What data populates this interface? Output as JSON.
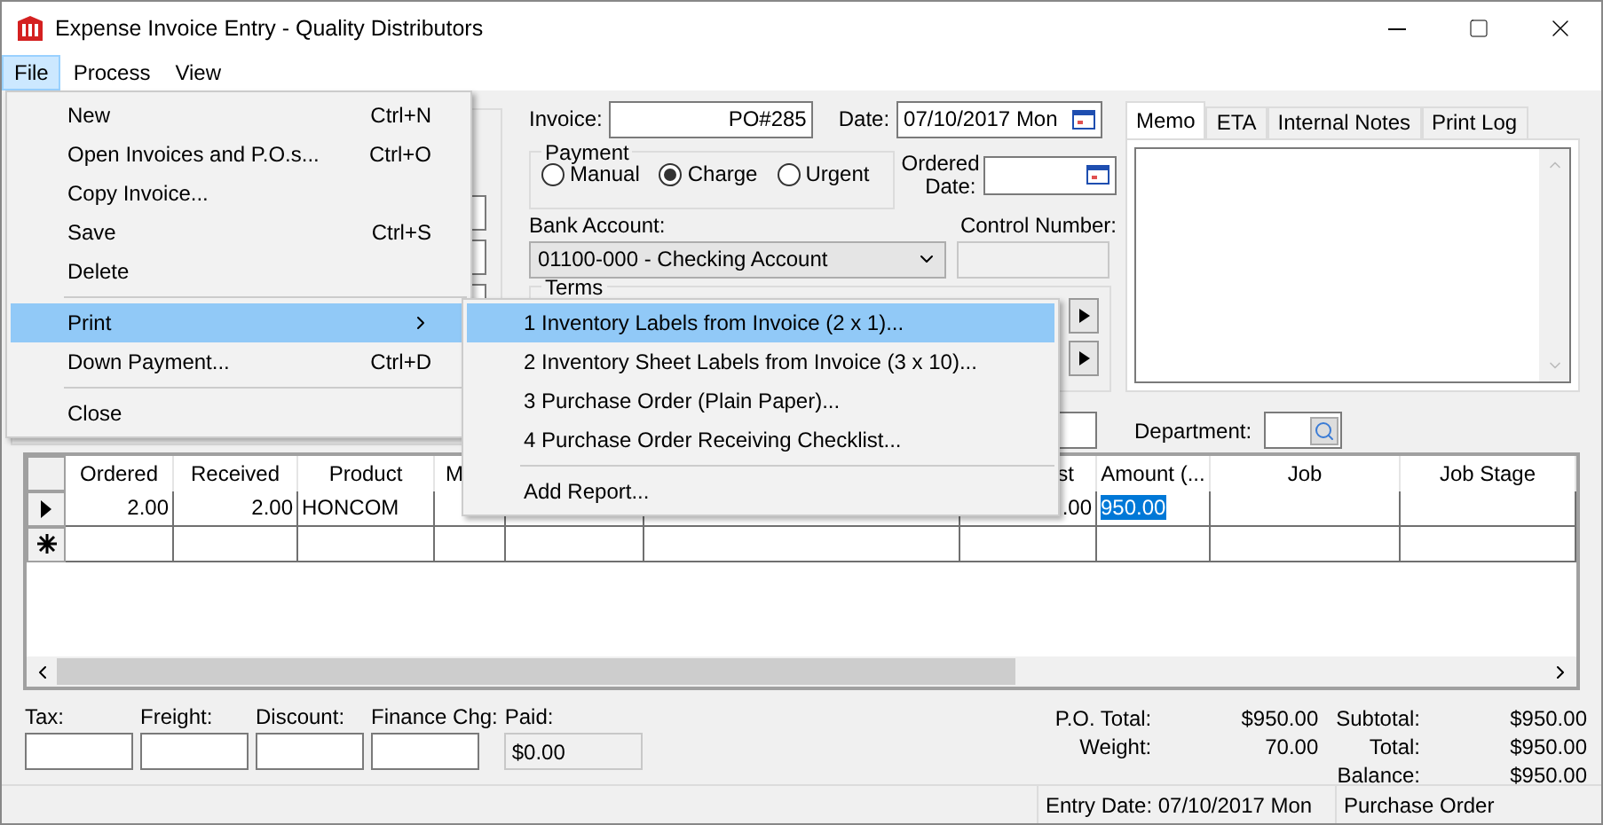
{
  "window": {
    "title": "Expense Invoice Entry - Quality Distributors"
  },
  "menu_bar": [
    {
      "label": "File",
      "selected": true
    },
    {
      "label": "Process",
      "selected": false
    },
    {
      "label": "View",
      "selected": false
    }
  ],
  "file_menu": [
    {
      "kind": "item",
      "label": "New",
      "shortcut": "Ctrl+N",
      "selected": false
    },
    {
      "kind": "item",
      "label": "Open Invoices and P.O.s...",
      "shortcut": "Ctrl+O",
      "selected": false
    },
    {
      "kind": "item",
      "label": "Copy Invoice...",
      "selected": false
    },
    {
      "kind": "item",
      "label": "Save",
      "shortcut": "Ctrl+S",
      "selected": false
    },
    {
      "kind": "item",
      "label": "Delete",
      "selected": false
    },
    {
      "kind": "separator"
    },
    {
      "kind": "submenu",
      "label": "Print",
      "selected": true
    },
    {
      "kind": "item",
      "label": "Down Payment...",
      "shortcut": "Ctrl+D",
      "selected": false
    },
    {
      "kind": "separator"
    },
    {
      "kind": "item",
      "label": "Close",
      "selected": false
    }
  ],
  "print_submenu": [
    {
      "kind": "item",
      "label": "1 Inventory Labels from Invoice (2 x 1)...",
      "selected": true
    },
    {
      "kind": "item",
      "label": "2 Inventory Sheet Labels from Invoice (3 x 10)...",
      "selected": false
    },
    {
      "kind": "item",
      "label": "3 Purchase Order (Plain Paper)...",
      "selected": false
    },
    {
      "kind": "item",
      "label": "4 Purchase Order Receiving Checklist...",
      "selected": false
    },
    {
      "kind": "separator"
    },
    {
      "kind": "item",
      "label": "Add Report...",
      "selected": false
    }
  ],
  "form": {
    "invoice_label": "Invoice:",
    "invoice": "PO#285",
    "date_label": "Date:",
    "date": "07/10/2017 Mon",
    "payment": {
      "title": "Payment",
      "options": [
        {
          "label": "Manual",
          "selected": false
        },
        {
          "label": "Charge",
          "selected": true
        },
        {
          "label": "Urgent",
          "selected": false
        }
      ]
    },
    "ordered_date_label": "Ordered Date:",
    "bank_account_label": "Bank Account:",
    "bank_account": "01100-000 - Checking Account",
    "control_number_label": "Control Number:",
    "terms_title": "Terms",
    "department_label": "Department:"
  },
  "notes_tabs": [
    {
      "label": "Memo",
      "selected": true
    },
    {
      "label": "ETA",
      "selected": false
    },
    {
      "label": "Internal Notes",
      "selected": false
    },
    {
      "label": "Print Log",
      "selected": false
    }
  ],
  "grid": {
    "columns": [
      {
        "label": "Ordered"
      },
      {
        "label": "Received"
      },
      {
        "label": "Product"
      },
      {
        "label": "M"
      },
      {},
      {},
      {
        "label": "st"
      },
      {
        "label": "Amount (..."
      },
      {
        "label": "Job"
      },
      {
        "label": "Job Stage"
      }
    ],
    "rows": [
      {
        "kind": "current",
        "cells": [
          {
            "text": "2.00",
            "selected": false
          },
          {
            "text": "2.00",
            "selected": false
          },
          {
            "text": "HONCOM",
            "selected": false
          },
          null,
          null,
          null,
          {
            "text": ".00",
            "selected": false
          },
          {
            "text": "950.00",
            "selected": true
          },
          null,
          null
        ]
      },
      {
        "kind": "new",
        "cells": [
          null,
          null,
          null,
          null,
          null,
          null,
          null,
          null,
          null,
          null
        ]
      }
    ]
  },
  "charges": [
    {
      "label": "Tax:",
      "disabled": false
    },
    {
      "label": "Freight:",
      "disabled": false
    },
    {
      "label": "Discount:",
      "disabled": false
    },
    {
      "label": "Finance Chg:",
      "disabled": false
    },
    {
      "label": "Paid:",
      "value": "$0.00",
      "disabled": true
    }
  ],
  "totals_left": [
    {
      "label": "P.O. Total:",
      "value": "$950.00"
    },
    {
      "label": "Weight:",
      "value": "70.00"
    }
  ],
  "totals_right": [
    {
      "label": "Subtotal:",
      "value": "$950.00"
    },
    {
      "label": "Total:",
      "value": "$950.00"
    },
    {
      "label": "Balance:",
      "value": "$950.00"
    }
  ],
  "status_bar": [
    "Entry Date: 07/10/2017 Mon",
    "Purchase Order"
  ]
}
